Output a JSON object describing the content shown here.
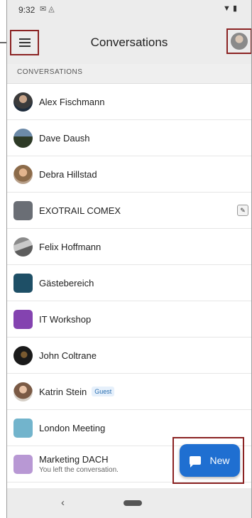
{
  "status": {
    "time": "9:32",
    "icons": [
      "mail-icon",
      "sync-icon"
    ],
    "right_icons": [
      "wifi-icon",
      "battery-icon"
    ]
  },
  "appbar": {
    "title": "Conversations",
    "menu_icon": "hamburger-icon",
    "profile_icon": "profile-avatar"
  },
  "section_header": "CONVERSATIONS",
  "colors": {
    "accent": "#1f6fd1",
    "highlight": "#8b2323"
  },
  "conversations": [
    {
      "name": "Alex Fischmann",
      "avatar": "photo"
    },
    {
      "name": "Dave Daush",
      "avatar": "photo"
    },
    {
      "name": "Debra Hillstad",
      "avatar": "photo"
    },
    {
      "name": "EXOTRAIL COMEX",
      "avatar": "#6a6e75",
      "muted": true
    },
    {
      "name": "Felix Hoffmann",
      "avatar": "photo"
    },
    {
      "name": "Gästebereich",
      "avatar": "#1e4f66"
    },
    {
      "name": "IT Workshop",
      "avatar": "#8443b0"
    },
    {
      "name": "John Coltrane",
      "avatar": "photo"
    },
    {
      "name": "Katrin Stein",
      "avatar": "photo",
      "badge": "Guest"
    },
    {
      "name": "London Meeting",
      "avatar": "#72b4cc"
    },
    {
      "name": "Marketing DACH",
      "avatar": "#b898d4",
      "subtitle": "You left the conversation."
    }
  ],
  "fab": {
    "label": "New",
    "icon": "chat-icon"
  },
  "navbar": {
    "back_glyph": "‹"
  }
}
